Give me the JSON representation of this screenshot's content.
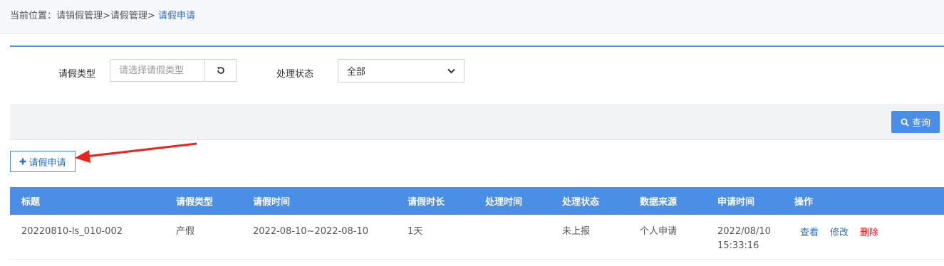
{
  "breadcrumb": {
    "prefix": "当前位置：请销假管理>请假管理>",
    "current": " 请假申请"
  },
  "filters": {
    "type_label": "请假类型",
    "type_placeholder": "请选择请假类型",
    "status_label": "处理状态",
    "status_value": "全部"
  },
  "actions": {
    "query_label": "查询",
    "add_label": "请假申请"
  },
  "table": {
    "columns": [
      "标题",
      "请假类型",
      "请假时间",
      "请假时长",
      "处理时间",
      "处理状态",
      "数据来源",
      "申请时间",
      "操作"
    ],
    "rows": [
      {
        "title": "20220810-ls_010-002",
        "type": "产假",
        "period": "2022-08-10~2022-08-10",
        "duration": "1天",
        "handled_time": "",
        "status": "未上报",
        "source": "个人申请",
        "apply_date": "2022/08/10",
        "apply_time": "15:33:16",
        "ops": {
          "view": "查看",
          "edit": "修改",
          "delete": "删除"
        }
      }
    ]
  },
  "colors": {
    "accent": "#4a8ee6",
    "link": "#2f6fbf",
    "danger": "#e02020",
    "annotation_arrow": "#e8241c"
  }
}
